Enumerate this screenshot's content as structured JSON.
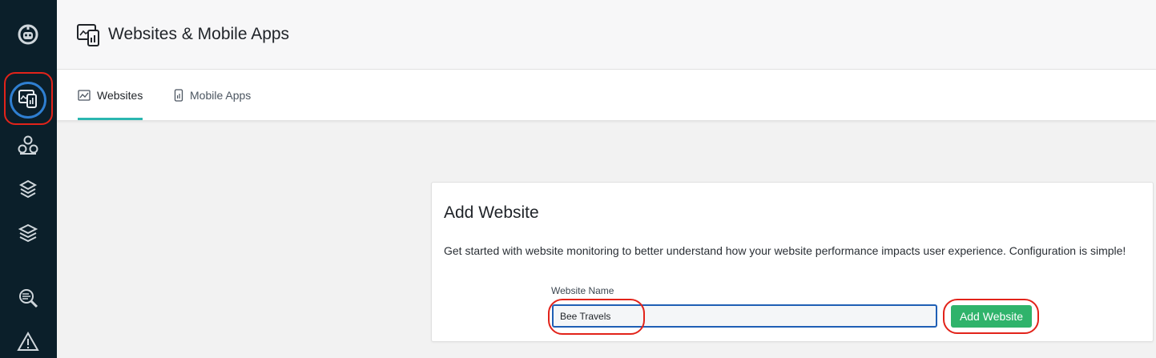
{
  "colors": {
    "sidebar_bg": "#0b1f2a",
    "active_ring": "#2f7fd1",
    "tab_underline": "#2bb6b0",
    "primary_button": "#2fb36b",
    "input_border": "#1f5fb5",
    "annotation": "#e2231a"
  },
  "sidebar": {
    "items": [
      {
        "icon": "robot-logo-icon"
      },
      {
        "icon": "websites-mobile-apps-icon",
        "active": true
      },
      {
        "icon": "services-cluster-icon"
      },
      {
        "icon": "infrastructure-gem-icon"
      },
      {
        "icon": "layers-stack-icon"
      },
      {
        "icon": "search-analytics-icon"
      },
      {
        "icon": "warning-triangle-icon"
      }
    ]
  },
  "header": {
    "title": "Websites & Mobile Apps",
    "icon": "websites-mobile-apps-icon"
  },
  "tabs": [
    {
      "label": "Websites",
      "icon": "website-chart-icon",
      "active": true
    },
    {
      "label": "Mobile Apps",
      "icon": "mobile-phone-icon",
      "active": false
    }
  ],
  "card": {
    "title": "Add Website",
    "description": "Get started with website monitoring to better understand how your website performance impacts user experience. Configuration is simple!",
    "field_label": "Website Name",
    "field_value": "Bee Travels",
    "button_label": "Add Website"
  }
}
